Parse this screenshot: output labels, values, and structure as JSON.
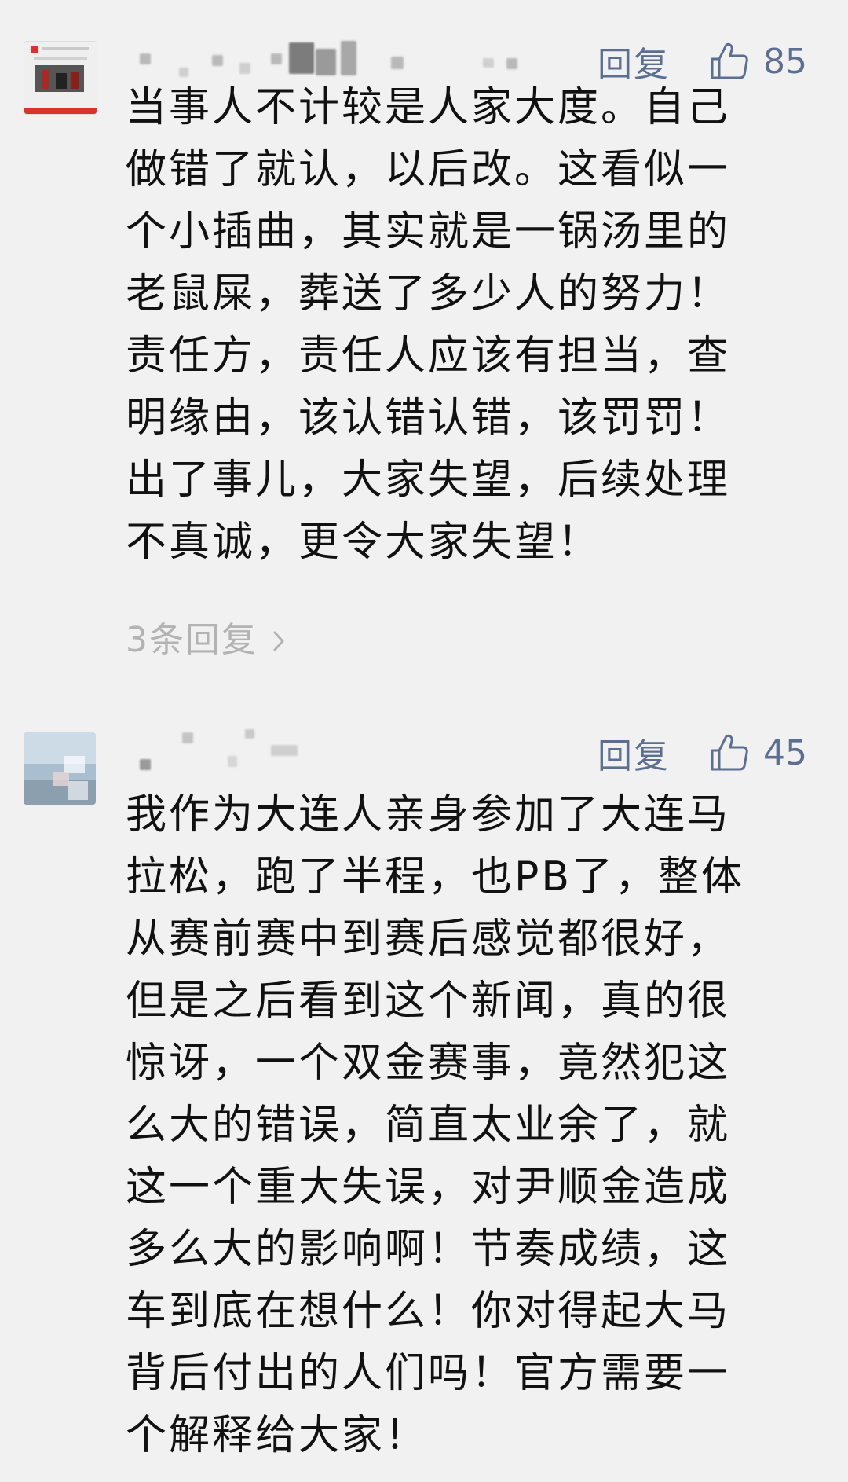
{
  "comments": [
    {
      "reply_label": "回复",
      "likes": "85",
      "lines": [
        "当事人不计较是人家大度。自己",
        "做错了就认，以后改。这看似一",
        "个小插曲，其实就是一锅汤里的",
        "老鼠屎，葬送了多少人的努力！",
        "责任方，责任人应该有担当，查",
        "明缘由，该认错认错，该罚罚！",
        "出了事儿，大家失望，后续处理",
        "不真诚，更令大家失望！"
      ],
      "reply_count": "3条回复",
      "reply_count_icon": "chevron-right-icon"
    },
    {
      "reply_label": "回复",
      "likes": "45",
      "lines": [
        "我作为大连人亲身参加了大连马",
        "拉松，跑了半程，也PB了，整体",
        "从赛前赛中到赛后感觉都很好，",
        "但是之后看到这个新闻，真的很",
        "惊讶，一个双金赛事，竟然犯这",
        "么大的错误，简直太业余了，就",
        "这一个重大失误，对尹顺金造成",
        "多么大的影响啊！节奏成绩，这",
        "车到底在想什么！你对得起大马",
        "背后付出的人们吗！官方需要一",
        "个解释给大家！"
      ]
    }
  ],
  "colors": {
    "background": "#f1f1f1",
    "link": "#5d6f90",
    "muted": "#b3b3b3",
    "text": "#111111"
  }
}
